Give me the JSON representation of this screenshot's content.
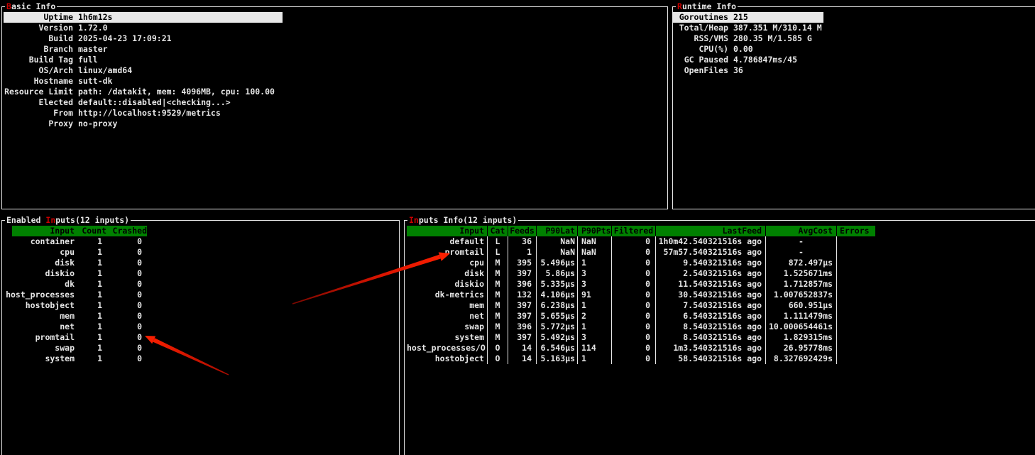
{
  "colors": {
    "background": "#000000",
    "border": "#e8e8e8",
    "header_green": "#008000",
    "hotkey_red": "#cc0000",
    "selection_bg": "#e8e8e8",
    "arrow_red": "#ff2000"
  },
  "panels": {
    "basic_info": {
      "title": {
        "pre": "",
        "hot": "B",
        "post": "asic Info"
      },
      "rows": [
        {
          "label": "Uptime",
          "value": "1h6m12s",
          "selected": true
        },
        {
          "label": "Version",
          "value": "1.72.0"
        },
        {
          "label": "Build",
          "value": "2025-04-23 17:09:21"
        },
        {
          "label": "Branch",
          "value": "master"
        },
        {
          "label": "Build Tag",
          "value": "full"
        },
        {
          "label": "OS/Arch",
          "value": "linux/amd64"
        },
        {
          "label": "Hostname",
          "value": "sutt-dk"
        },
        {
          "label": "Resource Limit",
          "value": "path: /datakit, mem: 4096MB, cpu: 100.00"
        },
        {
          "label": "Elected",
          "value": "default::disabled|<checking...>"
        },
        {
          "label": "From",
          "value": "http://localhost:9529/metrics"
        },
        {
          "label": "Proxy",
          "value": "no-proxy"
        }
      ]
    },
    "runtime_info": {
      "title": {
        "pre": "",
        "hot": "R",
        "post": "untime Info"
      },
      "rows": [
        {
          "label": "Goroutines",
          "value": "215",
          "selected": true
        },
        {
          "label": "Total/Heap",
          "value": "387.351 M/310.14 M"
        },
        {
          "label": "RSS/VMS",
          "value": "280.35 M/1.585 G"
        },
        {
          "label": "CPU(%)",
          "value": "0.00"
        },
        {
          "label": "GC Paused",
          "value": "4.786847ms/45"
        },
        {
          "label": "OpenFiles",
          "value": "36"
        }
      ]
    },
    "enabled_inputs": {
      "title": {
        "pre": "Enabled ",
        "hot": "In",
        "post": "puts(12 inputs)"
      },
      "table": {
        "columns": [
          {
            "key": "input",
            "label": "Input"
          },
          {
            "key": "count",
            "label": "Count"
          },
          {
            "key": "crashed",
            "label": "Crashed"
          }
        ],
        "rows": [
          {
            "input": "container",
            "count": "1",
            "crashed": "0"
          },
          {
            "input": "cpu",
            "count": "1",
            "crashed": "0"
          },
          {
            "input": "disk",
            "count": "1",
            "crashed": "0"
          },
          {
            "input": "diskio",
            "count": "1",
            "crashed": "0"
          },
          {
            "input": "dk",
            "count": "1",
            "crashed": "0"
          },
          {
            "input": "host_processes",
            "count": "1",
            "crashed": "0"
          },
          {
            "input": "hostobject",
            "count": "1",
            "crashed": "0"
          },
          {
            "input": "mem",
            "count": "1",
            "crashed": "0"
          },
          {
            "input": "net",
            "count": "1",
            "crashed": "0"
          },
          {
            "input": "promtail",
            "count": "1",
            "crashed": "0"
          },
          {
            "input": "swap",
            "count": "1",
            "crashed": "0"
          },
          {
            "input": "system",
            "count": "1",
            "crashed": "0"
          }
        ]
      }
    },
    "inputs_info": {
      "title": {
        "pre": "",
        "hot": "In",
        "post": "puts Info(12 inputs)"
      },
      "table": {
        "columns": [
          {
            "key": "input",
            "label": "Input"
          },
          {
            "key": "cat",
            "label": "Cat"
          },
          {
            "key": "feeds",
            "label": "Feeds"
          },
          {
            "key": "p90lat",
            "label": "P90Lat"
          },
          {
            "key": "p90pts",
            "label": "P90Pts"
          },
          {
            "key": "filtered",
            "label": "Filtered"
          },
          {
            "key": "lastfeed",
            "label": "LastFeed"
          },
          {
            "key": "avgcost",
            "label": "AvgCost"
          },
          {
            "key": "errors",
            "label": "Errors"
          }
        ],
        "rows": [
          {
            "input": "default",
            "cat": "L",
            "feeds": "36",
            "p90lat": "NaN",
            "p90pts": "NaN",
            "filtered": "0",
            "lastfeed": "1h0m42.540321516s ago",
            "avgcost": "-",
            "errors": ""
          },
          {
            "input": "promtail",
            "cat": "L",
            "feeds": "1",
            "p90lat": "NaN",
            "p90pts": "NaN",
            "filtered": "0",
            "lastfeed": "57m57.540321516s ago",
            "avgcost": "-",
            "errors": ""
          },
          {
            "input": "cpu",
            "cat": "M",
            "feeds": "395",
            "p90lat": "5.496µs",
            "p90pts": "1",
            "filtered": "0",
            "lastfeed": "9.540321516s ago",
            "avgcost": "872.497µs",
            "errors": ""
          },
          {
            "input": "disk",
            "cat": "M",
            "feeds": "397",
            "p90lat": "5.86µs",
            "p90pts": "3",
            "filtered": "0",
            "lastfeed": "2.540321516s ago",
            "avgcost": "1.525671ms",
            "errors": ""
          },
          {
            "input": "diskio",
            "cat": "M",
            "feeds": "396",
            "p90lat": "5.335µs",
            "p90pts": "3",
            "filtered": "0",
            "lastfeed": "11.540321516s ago",
            "avgcost": "1.712857ms",
            "errors": ""
          },
          {
            "input": "dk-metrics",
            "cat": "M",
            "feeds": "132",
            "p90lat": "4.106µs",
            "p90pts": "91",
            "filtered": "0",
            "lastfeed": "30.540321516s ago",
            "avgcost": "1.007652837s",
            "errors": ""
          },
          {
            "input": "mem",
            "cat": "M",
            "feeds": "397",
            "p90lat": "6.238µs",
            "p90pts": "1",
            "filtered": "0",
            "lastfeed": "7.540321516s ago",
            "avgcost": "660.951µs",
            "errors": ""
          },
          {
            "input": "net",
            "cat": "M",
            "feeds": "397",
            "p90lat": "5.655µs",
            "p90pts": "2",
            "filtered": "0",
            "lastfeed": "6.540321516s ago",
            "avgcost": "1.111479ms",
            "errors": ""
          },
          {
            "input": "swap",
            "cat": "M",
            "feeds": "396",
            "p90lat": "5.772µs",
            "p90pts": "1",
            "filtered": "0",
            "lastfeed": "8.540321516s ago",
            "avgcost": "10.000654461s",
            "errors": ""
          },
          {
            "input": "system",
            "cat": "M",
            "feeds": "397",
            "p90lat": "5.492µs",
            "p90pts": "3",
            "filtered": "0",
            "lastfeed": "8.540321516s ago",
            "avgcost": "1.829315ms",
            "errors": ""
          },
          {
            "input": "host_processes/O",
            "cat": "O",
            "feeds": "14",
            "p90lat": "6.546µs",
            "p90pts": "114",
            "filtered": "0",
            "lastfeed": "1m3.540321516s ago",
            "avgcost": "26.95778ms",
            "errors": ""
          },
          {
            "input": "hostobject",
            "cat": "O",
            "feeds": "14",
            "p90lat": "5.163µs",
            "p90pts": "1",
            "filtered": "0",
            "lastfeed": "58.540321516s ago",
            "avgcost": "8.327692429s",
            "errors": ""
          }
        ]
      }
    }
  }
}
